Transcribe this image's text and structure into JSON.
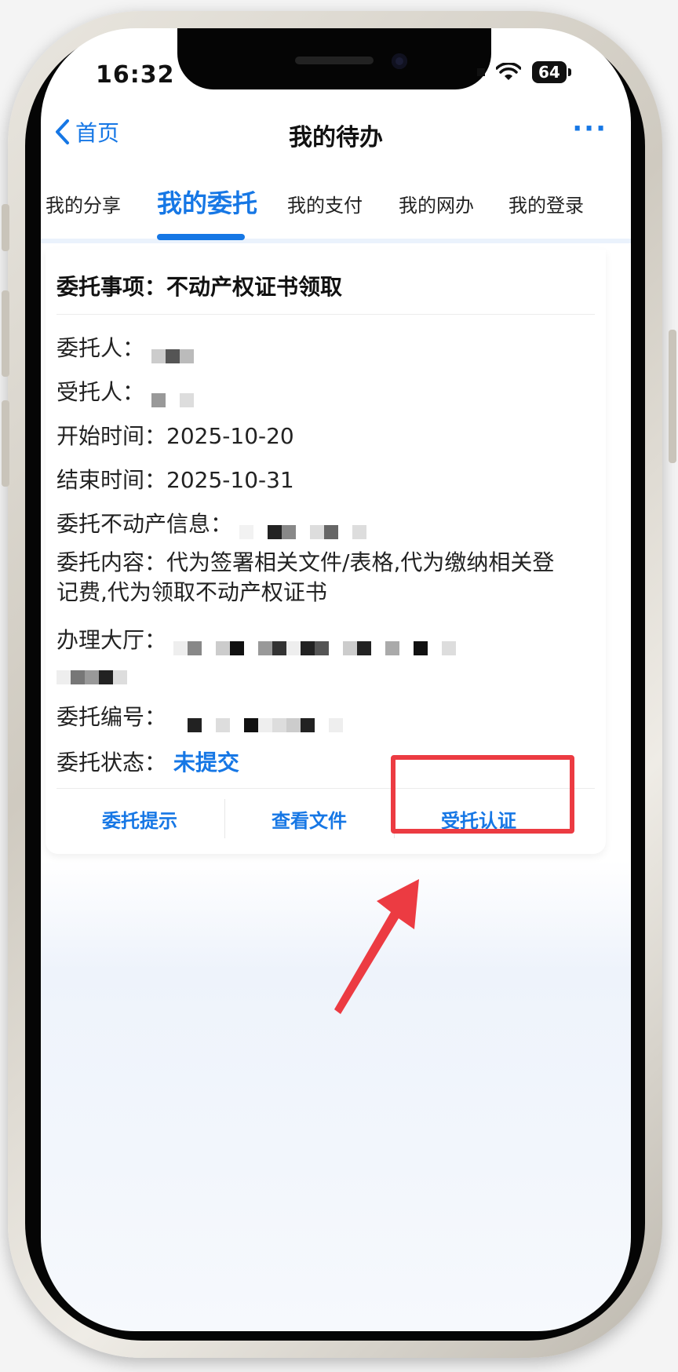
{
  "status_bar": {
    "time": "16:32",
    "battery": "64"
  },
  "nav": {
    "back_label": "首页",
    "title": "我的待办",
    "more_label": "···"
  },
  "tabs": [
    "我的分享",
    "我的委托",
    "我的支付",
    "我的网办",
    "我的登录"
  ],
  "active_tab": "我的委托",
  "card": {
    "title": "委托事项：不动产权证书领取",
    "fields": [
      {
        "label": "委托人：",
        "value": ""
      },
      {
        "label": "受托人：",
        "value": ""
      },
      {
        "label": "开始时间：",
        "value": "2025-10-20"
      },
      {
        "label": "结束时间：",
        "value": "2025-10-31"
      },
      {
        "label": "委托不动产信息：",
        "value": ""
      },
      {
        "label": "委托内容：",
        "value": "代为签署相关文件/表格,代为缴纳相关登记费,代为领取不动产权证书"
      },
      {
        "label": "办理大厅：",
        "value": ""
      },
      {
        "label": "委托编号：",
        "value": ""
      },
      {
        "label": "委托状态：",
        "value": "未提交"
      }
    ],
    "actions": [
      "委托提示",
      "查看文件",
      "受托认证"
    ]
  },
  "colors": {
    "accent": "#1677e5",
    "highlight": "#ec3b42"
  }
}
